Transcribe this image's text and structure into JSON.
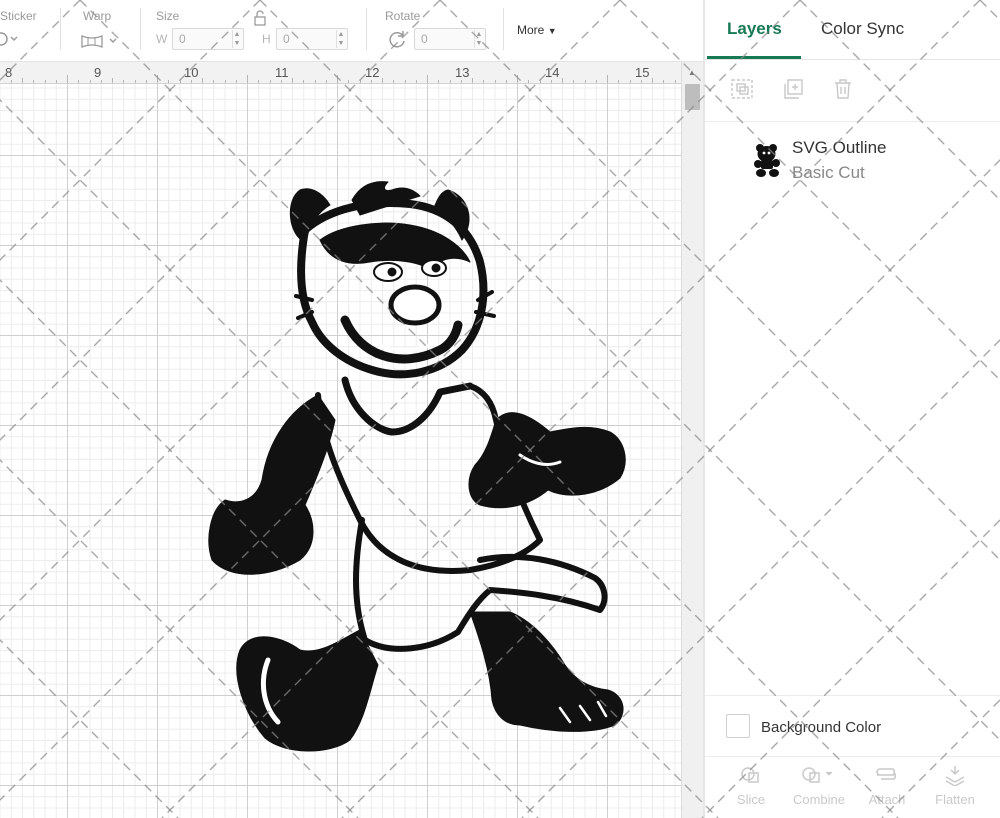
{
  "toolbar": {
    "sticker_label": "Sticker",
    "warp_label": "Warp",
    "size_label": "Size",
    "width_letter": "W",
    "width_value": "0",
    "height_letter": "H",
    "height_value": "0",
    "rotate_label": "Rotate",
    "rotate_value": "0",
    "more_label": "More"
  },
  "ruler": {
    "numbers": [
      "8",
      "9",
      "10",
      "11",
      "12",
      "13",
      "14",
      "15"
    ]
  },
  "canvas": {
    "design_name": "cartoon-cat-mascot-outline",
    "grid_color": "#cfcfcf"
  },
  "panel": {
    "tabs": [
      {
        "label": "Layers",
        "active": true
      },
      {
        "label": "Color Sync",
        "active": false
      }
    ],
    "layer": {
      "name": "SVG Outline",
      "type": "Basic Cut"
    },
    "background_color_label": "Background Color",
    "actions": [
      {
        "label": "Slice",
        "icon": "slice-icon"
      },
      {
        "label": "Combine",
        "icon": "combine-icon"
      },
      {
        "label": "Attach",
        "icon": "attach-icon"
      },
      {
        "label": "Flatten",
        "icon": "flatten-icon"
      }
    ]
  },
  "colors": {
    "accent": "#177a55",
    "muted_text": "#9a9a9a",
    "panel_border": "#e3e3e3"
  }
}
